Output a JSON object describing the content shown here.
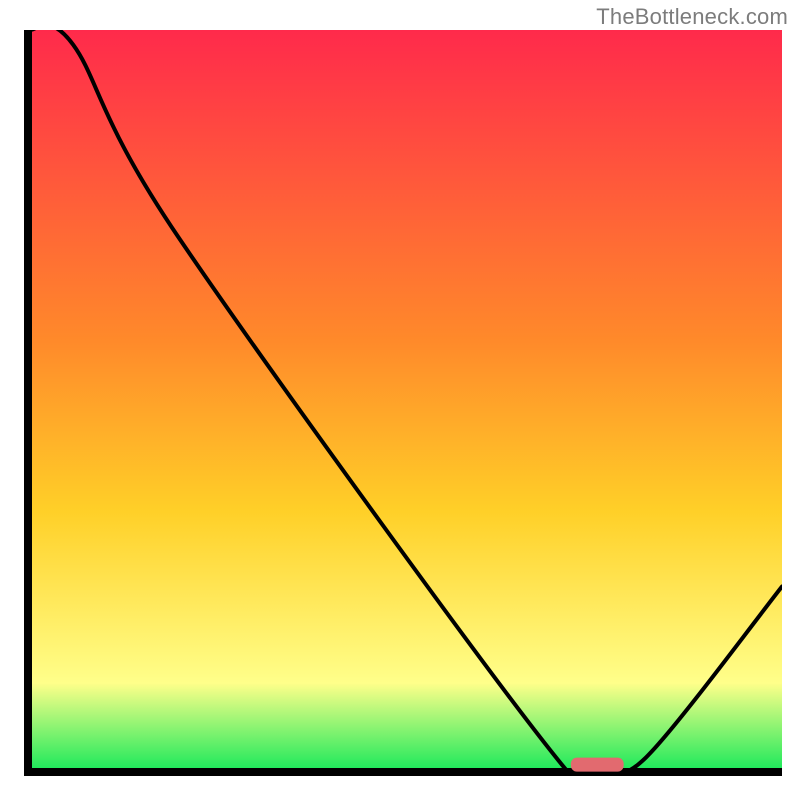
{
  "watermark": "TheBottleneck.com",
  "colors": {
    "axis": "#000000",
    "curve": "#000000",
    "marker_fill": "#e26a6f",
    "grad_top": "#ff2a4b",
    "grad_mid_high": "#ff8a2a",
    "grad_mid": "#ffd028",
    "grad_low_yellow": "#ffff8a",
    "grad_green": "#17e85a"
  },
  "chart_data": {
    "type": "line",
    "title": "",
    "xlabel": "",
    "ylabel": "",
    "xlim": [
      0,
      100
    ],
    "ylim": [
      0,
      100
    ],
    "x": [
      0,
      6,
      20,
      70,
      76,
      82,
      100
    ],
    "values": [
      100,
      98,
      72,
      2,
      1,
      2,
      25
    ],
    "marker": {
      "x_range": [
        72,
        79
      ],
      "y": 1
    },
    "note": "Single black curve over a vertical rainbow gradient background; ticks and numeric labels are not shown. The curve descends steeply from top-left, flattens near the bottom around x≈72–79 (highlighted by a small rounded red marker), then rises toward the right edge."
  }
}
